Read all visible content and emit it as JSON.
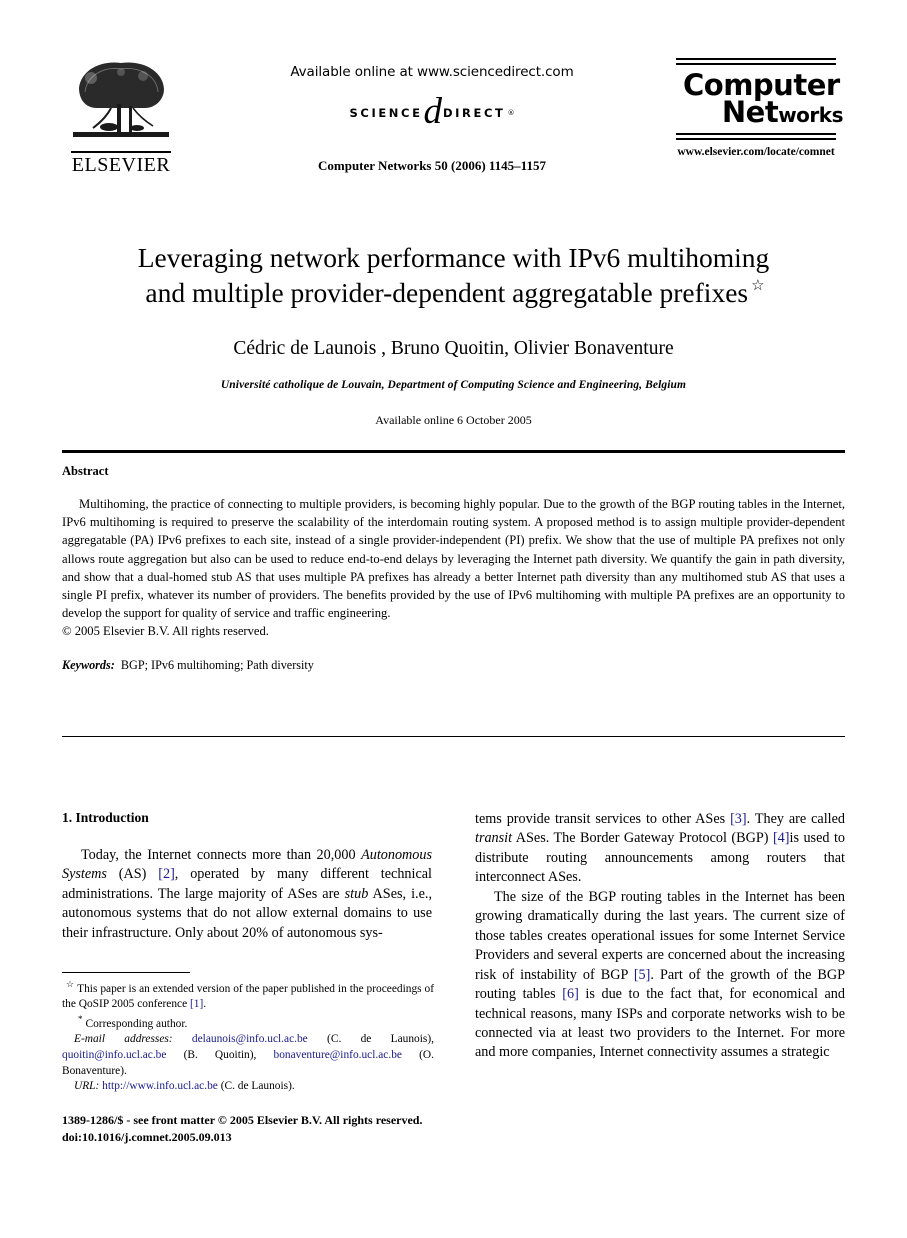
{
  "masthead": {
    "elsevier_wordmark": "ELSEVIER",
    "available_online": "Available online at www.sciencedirect.com",
    "sciencedirect": {
      "science": "SCIENCE",
      "direct": "DIRECT",
      "d_glyph": "d",
      "trademark": "®"
    },
    "journal_reference": "Computer Networks 50 (2006) 1145–1157",
    "journal_logo_line1": "Computer",
    "journal_logo_line2_a": "Net",
    "journal_logo_line2_b": "works",
    "journal_url": "www.elsevier.com/locate/comnet"
  },
  "title_block": {
    "title_line1": "Leveraging network performance with IPv6 multihoming",
    "title_line2": "and multiple provider-dependent aggregatable prefixes",
    "title_footnote_marker": "☆",
    "authors": "Cédric de Launois , Bruno Quoitin, Olivier Bonaventure",
    "author_footnote_marker": "*",
    "affiliation": "Université catholique de Louvain, Department of Computing Science and Engineering, Belgium",
    "available_online_date": "Available online 6 October 2005"
  },
  "abstract": {
    "heading": "Abstract",
    "body": "Multihoming, the practice of connecting to multiple providers, is becoming highly popular. Due to the growth of the BGP routing tables in the Internet, IPv6 multihoming is required to preserve the scalability of the interdomain routing system. A proposed method is to assign multiple provider-dependent aggregatable (PA) IPv6 prefixes to each site, instead of a single provider-independent (PI) prefix. We show that the use of multiple PA prefixes not only allows route aggregation but also can be used to reduce end-to-end delays by leveraging the Internet path diversity. We quantify the gain in path diversity, and show that a dual-homed stub AS that uses multiple PA prefixes has already a better Internet path diversity than any multihomed stub AS that uses a single PI prefix, whatever its number of providers. The benefits provided by the use of IPv6 multihoming with multiple PA prefixes are an opportunity to develop the support for quality of service and traffic engineering.",
    "copyright": "© 2005 Elsevier B.V. All rights reserved.",
    "keywords_label": "Keywords:",
    "keywords_value": "BGP; IPv6 multihoming; Path diversity"
  },
  "body": {
    "section_heading": "1. Introduction",
    "left_col": {
      "p1_a": "Today, the Internet connects more than 20,000 ",
      "p1_italic1": "Autonomous Systems",
      "p1_b": " (AS) ",
      "p1_ref1": "[2]",
      "p1_c": ", operated by many different technical administrations. The large majority of ASes are ",
      "p1_italic2": "stub",
      "p1_d": " ASes, i.e., autonomous systems that do not allow external domains to use their infrastructure. Only about 20% of autonomous sys-"
    },
    "right_col": {
      "p1_a": "tems provide transit services to other ASes ",
      "p1_ref1": "[3]",
      "p1_b": ". They are called ",
      "p1_italic1": "transit",
      "p1_c": " ASes. The Border Gateway Protocol (BGP) ",
      "p1_ref2": "[4]",
      "p1_d": "is used to distribute routing announcements among routers that interconnect ASes.",
      "p2_a": "The size of the BGP routing tables in the Internet has been growing dramatically during the last years. The current size of those tables creates operational issues for some Internet Service Providers and several experts are concerned about the increasing risk of instability of BGP ",
      "p2_ref1": "[5]",
      "p2_b": ". Part of the growth of the BGP routing tables ",
      "p2_ref2": "[6]",
      "p2_c": " is due to the fact that, for economical and technical reasons, many ISPs and corporate networks wish to be connected via at least two providers to the Internet. For more and more companies, Internet connectivity assumes a strategic"
    }
  },
  "footnotes": {
    "star_marker": "☆",
    "fn1": "This paper is an extended version of the paper published in the proceedings of the QoSIP 2005 conference ",
    "fn1_ref": "[1]",
    "fn1_end": ".",
    "corr_marker": "*",
    "fn2": "Corresponding author.",
    "email_label": "E-mail addresses:",
    "email1": "delaunois@info.ucl.ac.be",
    "email1_name": " (C. de Launois),",
    "email2": "quoitin@info.ucl.ac.be",
    "email2_name": " (B. Quoitin),",
    "email3": "bonaventure@info.ucl.ac.be",
    "email3_name": "(O. Bonaventure).",
    "url_label": "URL:",
    "url_value": "http://www.info.ucl.ac.be",
    "url_name": " (C. de Launois)."
  },
  "footer": {
    "issn_line": "1389-1286/$ - see front matter © 2005 Elsevier B.V. All rights reserved.",
    "doi_line": "doi:10.1016/j.comnet.2005.09.013"
  },
  "colors": {
    "link": "#1a1a8e",
    "text": "#000000",
    "background": "#ffffff"
  }
}
